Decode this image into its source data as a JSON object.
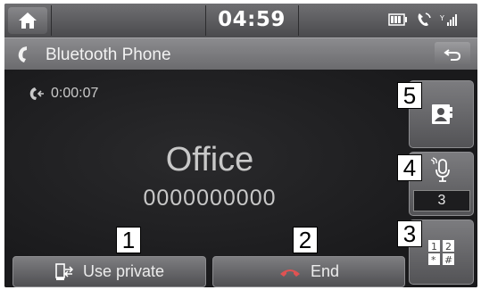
{
  "status_bar": {
    "time": "04:59",
    "icons": [
      "home-icon",
      "battery-icon",
      "phone-call-icon",
      "signal-icon"
    ]
  },
  "title_bar": {
    "title": "Bluetooth Phone",
    "icons": [
      "phone-icon",
      "back-icon"
    ]
  },
  "call": {
    "duration": "0:00:07",
    "caller_name": "Office",
    "caller_number": "0000000000"
  },
  "side_buttons": {
    "mic_volume": "3",
    "icons": [
      "contacts-icon",
      "mic-mute-icon",
      "keypad-icon"
    ]
  },
  "bottom_buttons": {
    "private_label": "Use private",
    "end_label": "End"
  },
  "callouts": [
    "1",
    "2",
    "3",
    "4",
    "5"
  ]
}
